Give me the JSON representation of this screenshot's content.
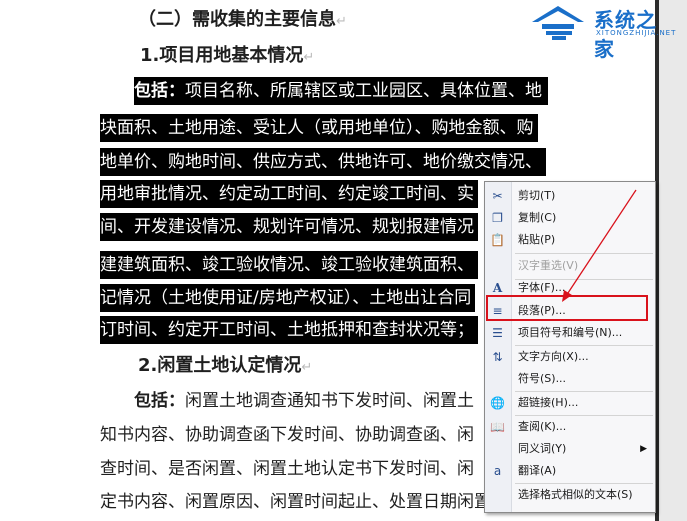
{
  "watermark": {
    "title": "系统之家",
    "subtitle": "XITONGZHIJIA.NET"
  },
  "doc": {
    "heading2": "（二）需收集的主要信息",
    "heading3a": "1.项目用地基本情况",
    "para1": [
      {
        "bold": "包括：",
        "text": "项目名称、所属辖区或工业园区、具体位置、地"
      },
      {
        "text": "块面积、土地用途、受让人（或用地单位）、购地金额、购"
      },
      {
        "text": "地单价、购地时间、供应方式、供地许可、地价缴交情况、"
      },
      {
        "text": "用地审批情况、约定动工时间、约定竣工时间、实"
      },
      {
        "text": "间、开发建设情况、规划许可情况、规划报建情况"
      },
      {
        "text": "建建筑面积、竣工验收情况、竣工验收建筑面积、"
      },
      {
        "text": "记情况（土地使用证/房地产权证）、土地出让合同"
      },
      {
        "text": "订时间、约定开工时间、土地抵押和查封状况等；"
      }
    ],
    "heading3b": "2.闲置土地认定情况",
    "para2": [
      {
        "bold": "包括：",
        "text": "闲置土地调查通知书下发时间、闲置土"
      },
      {
        "text": "知书内容、协助调查函下发时间、协助调查函、闲"
      },
      {
        "text": "查时间、是否闲置、闲置土地认定书下发时间、闲"
      },
      {
        "text": "定书内容、闲置原因、闲置时间起止、处置日期闲置土地"
      }
    ],
    "para_mark": "↵"
  },
  "context_menu": {
    "items": [
      {
        "label": "剪切(T)",
        "icon": "scissors-icon",
        "glyph": "✂",
        "enabled": true
      },
      {
        "label": "复制(C)",
        "icon": "copy-icon",
        "glyph": "❐",
        "enabled": true
      },
      {
        "label": "粘贴(P)",
        "icon": "paste-icon",
        "glyph": "📋",
        "enabled": true
      },
      {
        "label": "汉字重选(V)",
        "icon": "",
        "glyph": "",
        "enabled": false
      },
      {
        "label": "字体(F)...",
        "icon": "font-icon",
        "glyph": "A",
        "enabled": true
      },
      {
        "label": "段落(P)...",
        "icon": "paragraph-icon",
        "glyph": "≡",
        "enabled": true
      },
      {
        "label": "项目符号和编号(N)...",
        "icon": "bullets-icon",
        "glyph": "☰",
        "enabled": true
      },
      {
        "label": "文字方向(X)...",
        "icon": "text-direction-icon",
        "glyph": "⇅",
        "enabled": true
      },
      {
        "label": "符号(S)...",
        "icon": "",
        "glyph": "",
        "enabled": true
      },
      {
        "label": "超链接(H)...",
        "icon": "hyperlink-icon",
        "glyph": "🌐",
        "enabled": true
      },
      {
        "label": "查阅(K)...",
        "icon": "lookup-icon",
        "glyph": "📖",
        "enabled": true
      },
      {
        "label": "同义词(Y)",
        "icon": "",
        "glyph": "",
        "enabled": true,
        "submenu": true
      },
      {
        "label": "翻译(A)",
        "icon": "translate-icon",
        "glyph": "a",
        "enabled": true
      },
      {
        "label": "选择格式相似的文本(S)",
        "icon": "",
        "glyph": "",
        "enabled": true
      }
    ],
    "highlighted": "段落(P)...",
    "highlight_color": "#d9121c"
  }
}
